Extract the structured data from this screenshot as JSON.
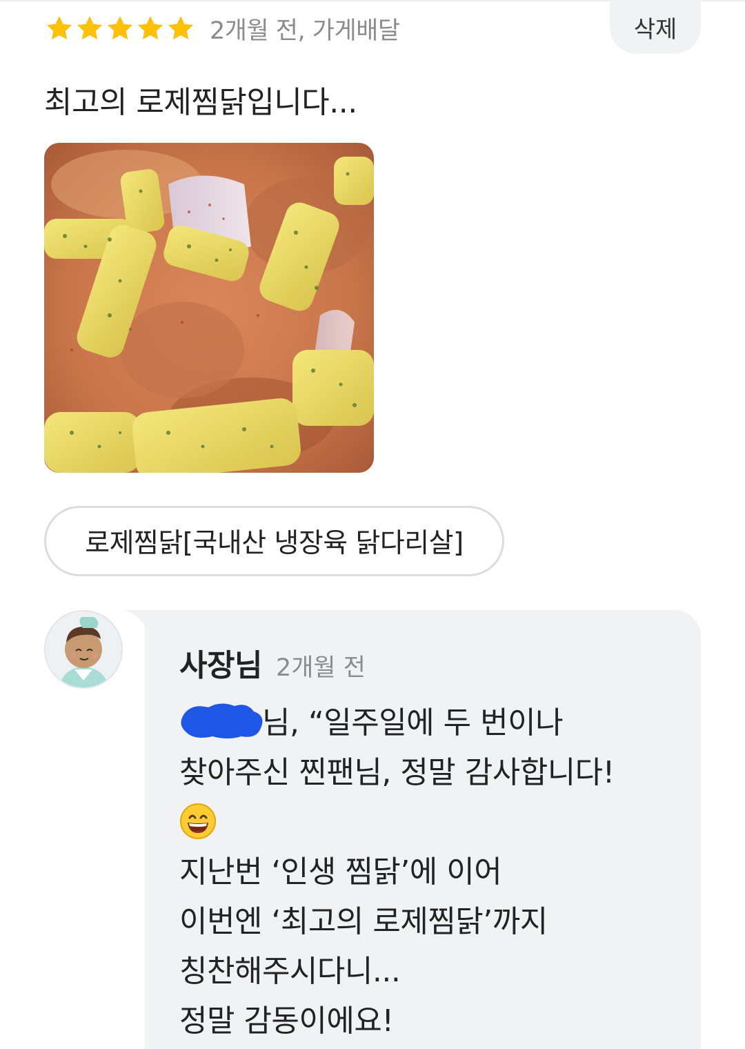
{
  "review": {
    "rating": 5,
    "rating_max": 5,
    "star_color": "#FFC107",
    "meta": "2개월 전, 가게배달",
    "delete_label": "삭제",
    "text": "최고의 로제찜닭입니다...",
    "menu_item": "로제찜닭[국내산 냉장육 닭다리살]"
  },
  "reply": {
    "owner_name": "사장님",
    "time": "2개월 전",
    "lines": [
      "님, “일주일에 두 번이나",
      "찾아주신 찐팬님, 정말 감사합니다!",
      "",
      "지난번 ‘인생 찜닭’에 이어",
      "이번엔 ‘최고의 로제찜닭’까지",
      "칭찬해주시다니...",
      "정말 감동이에요!"
    ],
    "emoji": "grinning-face-emoji",
    "redaction_color": "#1e56e6"
  }
}
